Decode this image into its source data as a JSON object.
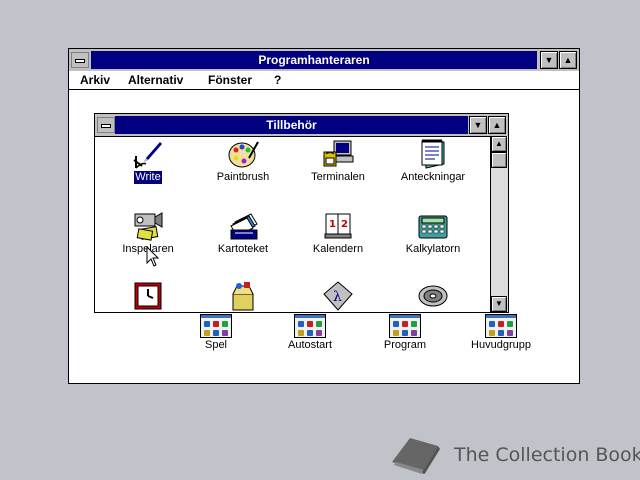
{
  "window": {
    "title": "Programhanteraren",
    "min_symbol": "▼",
    "max_symbol": "▲"
  },
  "menu": [
    {
      "label": "Arkiv"
    },
    {
      "label": "Alternativ"
    },
    {
      "label": "Fönster"
    },
    {
      "label": "?"
    }
  ],
  "child_window": {
    "title": "Tillbehör",
    "min_symbol": "▼",
    "max_symbol": "▲",
    "scroll_up": "▲",
    "scroll_down": "▼",
    "icons": [
      {
        "label": "Write",
        "icon": "write-icon",
        "selected": true
      },
      {
        "label": "Paintbrush",
        "icon": "paintbrush-icon"
      },
      {
        "label": "Terminalen",
        "icon": "terminal-icon"
      },
      {
        "label": "Anteckningar",
        "icon": "notepad-icon"
      },
      {
        "label": "Inspelaren",
        "icon": "recorder-icon"
      },
      {
        "label": "Kartoteket",
        "icon": "cardfile-icon"
      },
      {
        "label": "Kalendern",
        "icon": "calendar-icon"
      },
      {
        "label": "Kalkylatorn",
        "icon": "calculator-icon"
      },
      {
        "label": "",
        "icon": "clock-icon"
      },
      {
        "label": "",
        "icon": "object-packager-icon"
      },
      {
        "label": "",
        "icon": "character-map-icon"
      },
      {
        "label": "",
        "icon": "media-player-icon"
      }
    ]
  },
  "groups": [
    {
      "label": "Spel"
    },
    {
      "label": "Autostart"
    },
    {
      "label": "Program"
    },
    {
      "label": "Huvudgrupp"
    }
  ],
  "watermark": {
    "text": "The Collection Book"
  },
  "colors": {
    "title_active": "#000080",
    "desktop": "#c0c3c9",
    "face": "#c0c0c0"
  }
}
